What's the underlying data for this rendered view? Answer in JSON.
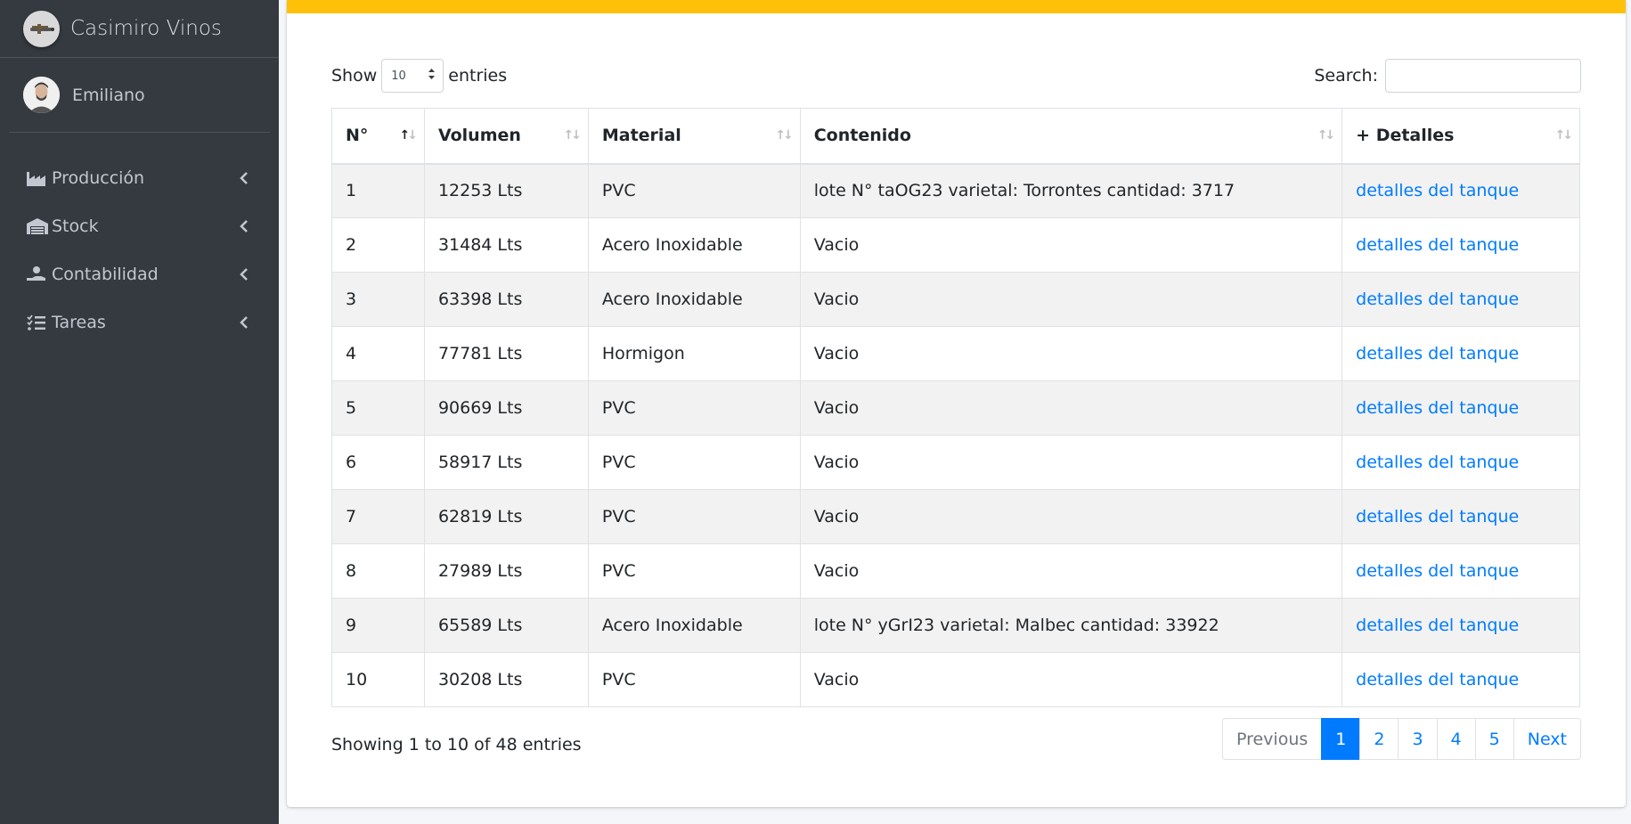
{
  "brand": {
    "name": "Casimiro Vinos"
  },
  "user": {
    "name": "Emiliano"
  },
  "sidebar": {
    "items": [
      {
        "label": "Producción",
        "icon": "industry-icon"
      },
      {
        "label": "Stock",
        "icon": "warehouse-icon"
      },
      {
        "label": "Contabilidad",
        "icon": "hand-holding-dollar-icon"
      },
      {
        "label": "Tareas",
        "icon": "tasks-icon"
      }
    ]
  },
  "colors": {
    "accent_bar": "#ffc107",
    "link": "#007bff",
    "sidebar_bg": "#343a40"
  },
  "length_menu": {
    "show_label": "Show",
    "value": "10",
    "entries_label": "entries"
  },
  "search": {
    "label": "Search:",
    "value": ""
  },
  "table": {
    "columns": [
      "N°",
      "Volumen",
      "Material",
      "Contenido",
      "+ Detalles"
    ],
    "rows": [
      [
        "1",
        "12253 Lts",
        "PVC",
        "lote N° taOG23 varietal: Torrontes cantidad: 3717",
        "detalles del tanque"
      ],
      [
        "2",
        "31484 Lts",
        "Acero Inoxidable",
        "Vacio",
        "detalles del tanque"
      ],
      [
        "3",
        "63398 Lts",
        "Acero Inoxidable",
        "Vacio",
        "detalles del tanque"
      ],
      [
        "4",
        "77781 Lts",
        "Hormigon",
        "Vacio",
        "detalles del tanque"
      ],
      [
        "5",
        "90669 Lts",
        "PVC",
        "Vacio",
        "detalles del tanque"
      ],
      [
        "6",
        "58917 Lts",
        "PVC",
        "Vacio",
        "detalles del tanque"
      ],
      [
        "7",
        "62819 Lts",
        "PVC",
        "Vacio",
        "detalles del tanque"
      ],
      [
        "8",
        "27989 Lts",
        "PVC",
        "Vacio",
        "detalles del tanque"
      ],
      [
        "9",
        "65589 Lts",
        "Acero Inoxidable",
        "lote N° yGrI23 varietal: Malbec cantidad: 33922",
        "detalles del tanque"
      ],
      [
        "10",
        "30208 Lts",
        "PVC",
        "Vacio",
        "detalles del tanque"
      ]
    ]
  },
  "info": {
    "text": "Showing 1 to 10 of 48 entries"
  },
  "pagination": {
    "previous": "Previous",
    "pages": [
      "1",
      "2",
      "3",
      "4",
      "5"
    ],
    "active": "1",
    "next": "Next"
  }
}
